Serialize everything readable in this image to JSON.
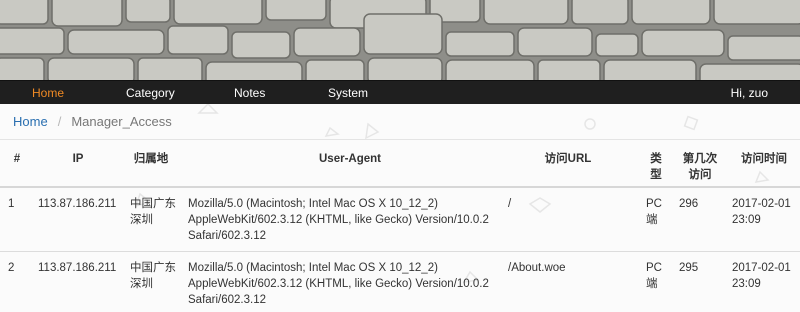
{
  "nav": {
    "items": [
      {
        "label": "Home",
        "active": true
      },
      {
        "label": "Category",
        "active": false
      },
      {
        "label": "Notes",
        "active": false
      },
      {
        "label": "System",
        "active": false
      }
    ],
    "user_greeting": "Hi, zuo",
    "active_color": "#f08a24"
  },
  "breadcrumb": {
    "home": "Home",
    "separator": "/",
    "current": "Manager_Access"
  },
  "table": {
    "headers": {
      "index": "#",
      "ip": "IP",
      "location": "归属地",
      "user_agent": "User-Agent",
      "url": "访问URL",
      "type_line1": "类",
      "type_line2": "型",
      "visits_line1": "第几次",
      "visits_line2": "访问",
      "time": "访问时间"
    },
    "rows": [
      {
        "index": "1",
        "ip": "113.87.186.211",
        "location_line1": "中国广东",
        "location_line2": "深圳",
        "ua_line1": "Mozilla/5.0 (Macintosh; Intel Mac OS X 10_12_2)",
        "ua_line2": "AppleWebKit/602.3.12 (KHTML, like Gecko) Version/10.0.2",
        "ua_line3": "Safari/602.3.12",
        "url": "/",
        "type_line1": "PC",
        "type_line2": "端",
        "visits": "296",
        "time_line1": "2017-02-01",
        "time_line2": "23:09"
      },
      {
        "index": "2",
        "ip": "113.87.186.211",
        "location_line1": "中国广东",
        "location_line2": "深圳",
        "ua_line1": "Mozilla/5.0 (Macintosh; Intel Mac OS X 10_12_2)",
        "ua_line2": "AppleWebKit/602.3.12 (KHTML, like Gecko) Version/10.0.2",
        "ua_line3": "Safari/602.3.12",
        "url": "/About.woe",
        "type_line1": "PC",
        "type_line2": "端",
        "visits": "295",
        "time_line1": "2017-02-01",
        "time_line2": "23:09"
      }
    ]
  }
}
